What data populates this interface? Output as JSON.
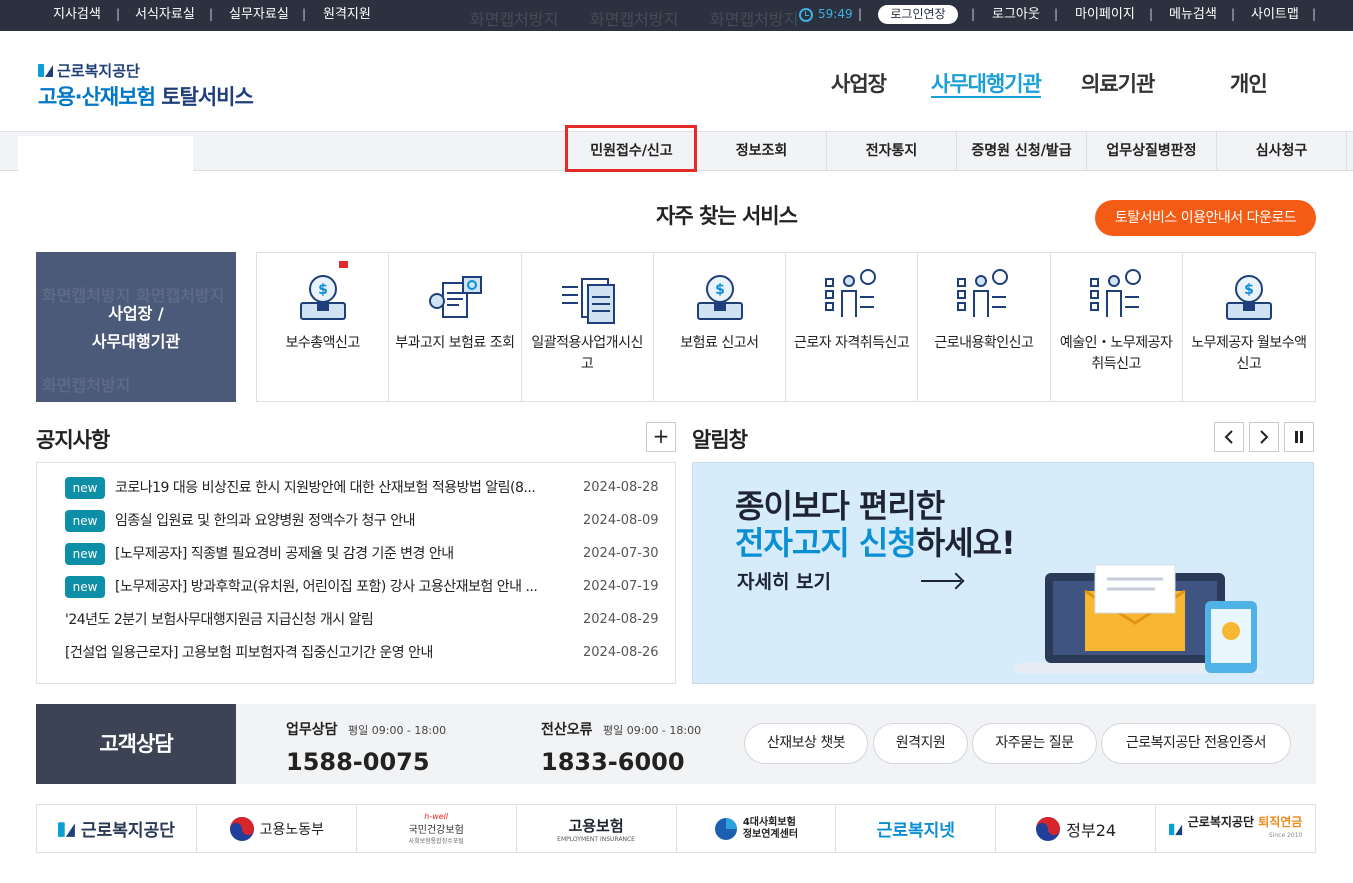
{
  "topbar": {
    "left_links": [
      "지사검색",
      "서식자료실",
      "실무자료실",
      "원격지원"
    ],
    "timer": "59:49",
    "extend_button": "로그인연장",
    "right_links": [
      "로그아웃",
      "마이페이지",
      "메뉴검색",
      "사이트맵"
    ],
    "separator": "|"
  },
  "header": {
    "logo_org": "근로복지공단",
    "logo_service_a": "고용·산재보험",
    "logo_service_b": " 토탈서비스",
    "nav": [
      "사업장",
      "사무대행기관",
      "의료기관",
      "개인"
    ],
    "active_nav": "사무대행기관"
  },
  "subnav": {
    "tabs": [
      "민원접수/신고",
      "정보조회",
      "전자통지",
      "증명원 신청/발급",
      "업무상질병판정",
      "심사청구"
    ],
    "highlighted": "민원접수/신고"
  },
  "favorites": {
    "title": "자주 찾는 서비스",
    "download_button": "토탈서비스 이용안내서 다운로드",
    "category_line1": "사업장 /",
    "category_line2": "사무대행기관",
    "services": [
      "보수총액신고",
      "부과고지 보험료 조회",
      "일괄적용사업개시신고",
      "보험료 신고서",
      "근로자 자격취득신고",
      "근로내용확인신고",
      "예술인・노무제공자 취득신고",
      "노무제공자 월보수액 신고"
    ],
    "icons": [
      "money-bulb-icon",
      "document-search-icon",
      "document-arrows-icon",
      "money-bulb-icon",
      "person-checklist-icon",
      "person-checklist-icon",
      "person-checklist-icon",
      "money-bulb-icon"
    ]
  },
  "notice": {
    "title": "공지사항",
    "more": "+",
    "new_badge": "new",
    "items": [
      {
        "new": true,
        "title": "코로나19 대응 비상진료 한시 지원방안에 대한 산재보험 적용방법 알림(8...",
        "date": "2024-08-28"
      },
      {
        "new": true,
        "title": "임종실 입원료 및 한의과 요양병원 정액수가 청구 안내",
        "date": "2024-08-09"
      },
      {
        "new": true,
        "title": "[노무제공자] 직종별 필요경비 공제율 및 감경 기준 변경 안내",
        "date": "2024-07-30"
      },
      {
        "new": true,
        "title": "[노무제공자] 방과후학교(유치원, 어린이집 포함) 강사 고용산재보험 안내 ...",
        "date": "2024-07-19"
      },
      {
        "new": false,
        "title": "'24년도 2분기 보험사무대행지원금 지급신청 개시 알림",
        "date": "2024-08-29"
      },
      {
        "new": false,
        "title": "[건설업 일용근로자] 고용보험 피보험자격 집중신고기간 운영 안내",
        "date": "2024-08-26"
      }
    ]
  },
  "alerts": {
    "title": "알림창",
    "banner_line1": "종이보다 편리한",
    "banner_line2_blue": "전자고지 신청",
    "banner_line2_rest": "하세요!",
    "banner_more": "자세히 보기"
  },
  "consult": {
    "title": "고객상담",
    "work_label": "업무상담",
    "work_hours": "평일 09:00 - 18:00",
    "work_number": "1588-0075",
    "it_label": "전산오류",
    "it_hours": "평일 09:00 - 18:00",
    "it_number": "1833-6000",
    "buttons": [
      "산재보상 챗봇",
      "원격지원",
      "자주묻는 질문",
      "근로복지공단 전용인증서"
    ]
  },
  "partners": {
    "logos": [
      "근로복지공단",
      "고용노동부",
      "국민건강보험",
      "고용보험",
      "4대사회보험 정보연계센터",
      "근로복지넷",
      "정부24",
      "근로복지공단 퇴직연금"
    ],
    "sub_texts": {
      "health_top": "h-well",
      "health_bottom": "사회보험통합징수포털",
      "ei_sub": "EMPLOYMENT INSURANCE",
      "pension_sub": "Since 2010",
      "fourins_line1": "4대사회보험",
      "fourins_line2": "정보연계센터",
      "pension_main": "근로복지공단 ",
      "pension_hl": "퇴직연금"
    }
  },
  "colors": {
    "topbar": "#2c3140",
    "brand": "#1f3f7a",
    "accent": "#1a9fd7",
    "orange": "#f45b15",
    "new_badge": "#0d8fa8",
    "highlight": "#e52a2a"
  }
}
